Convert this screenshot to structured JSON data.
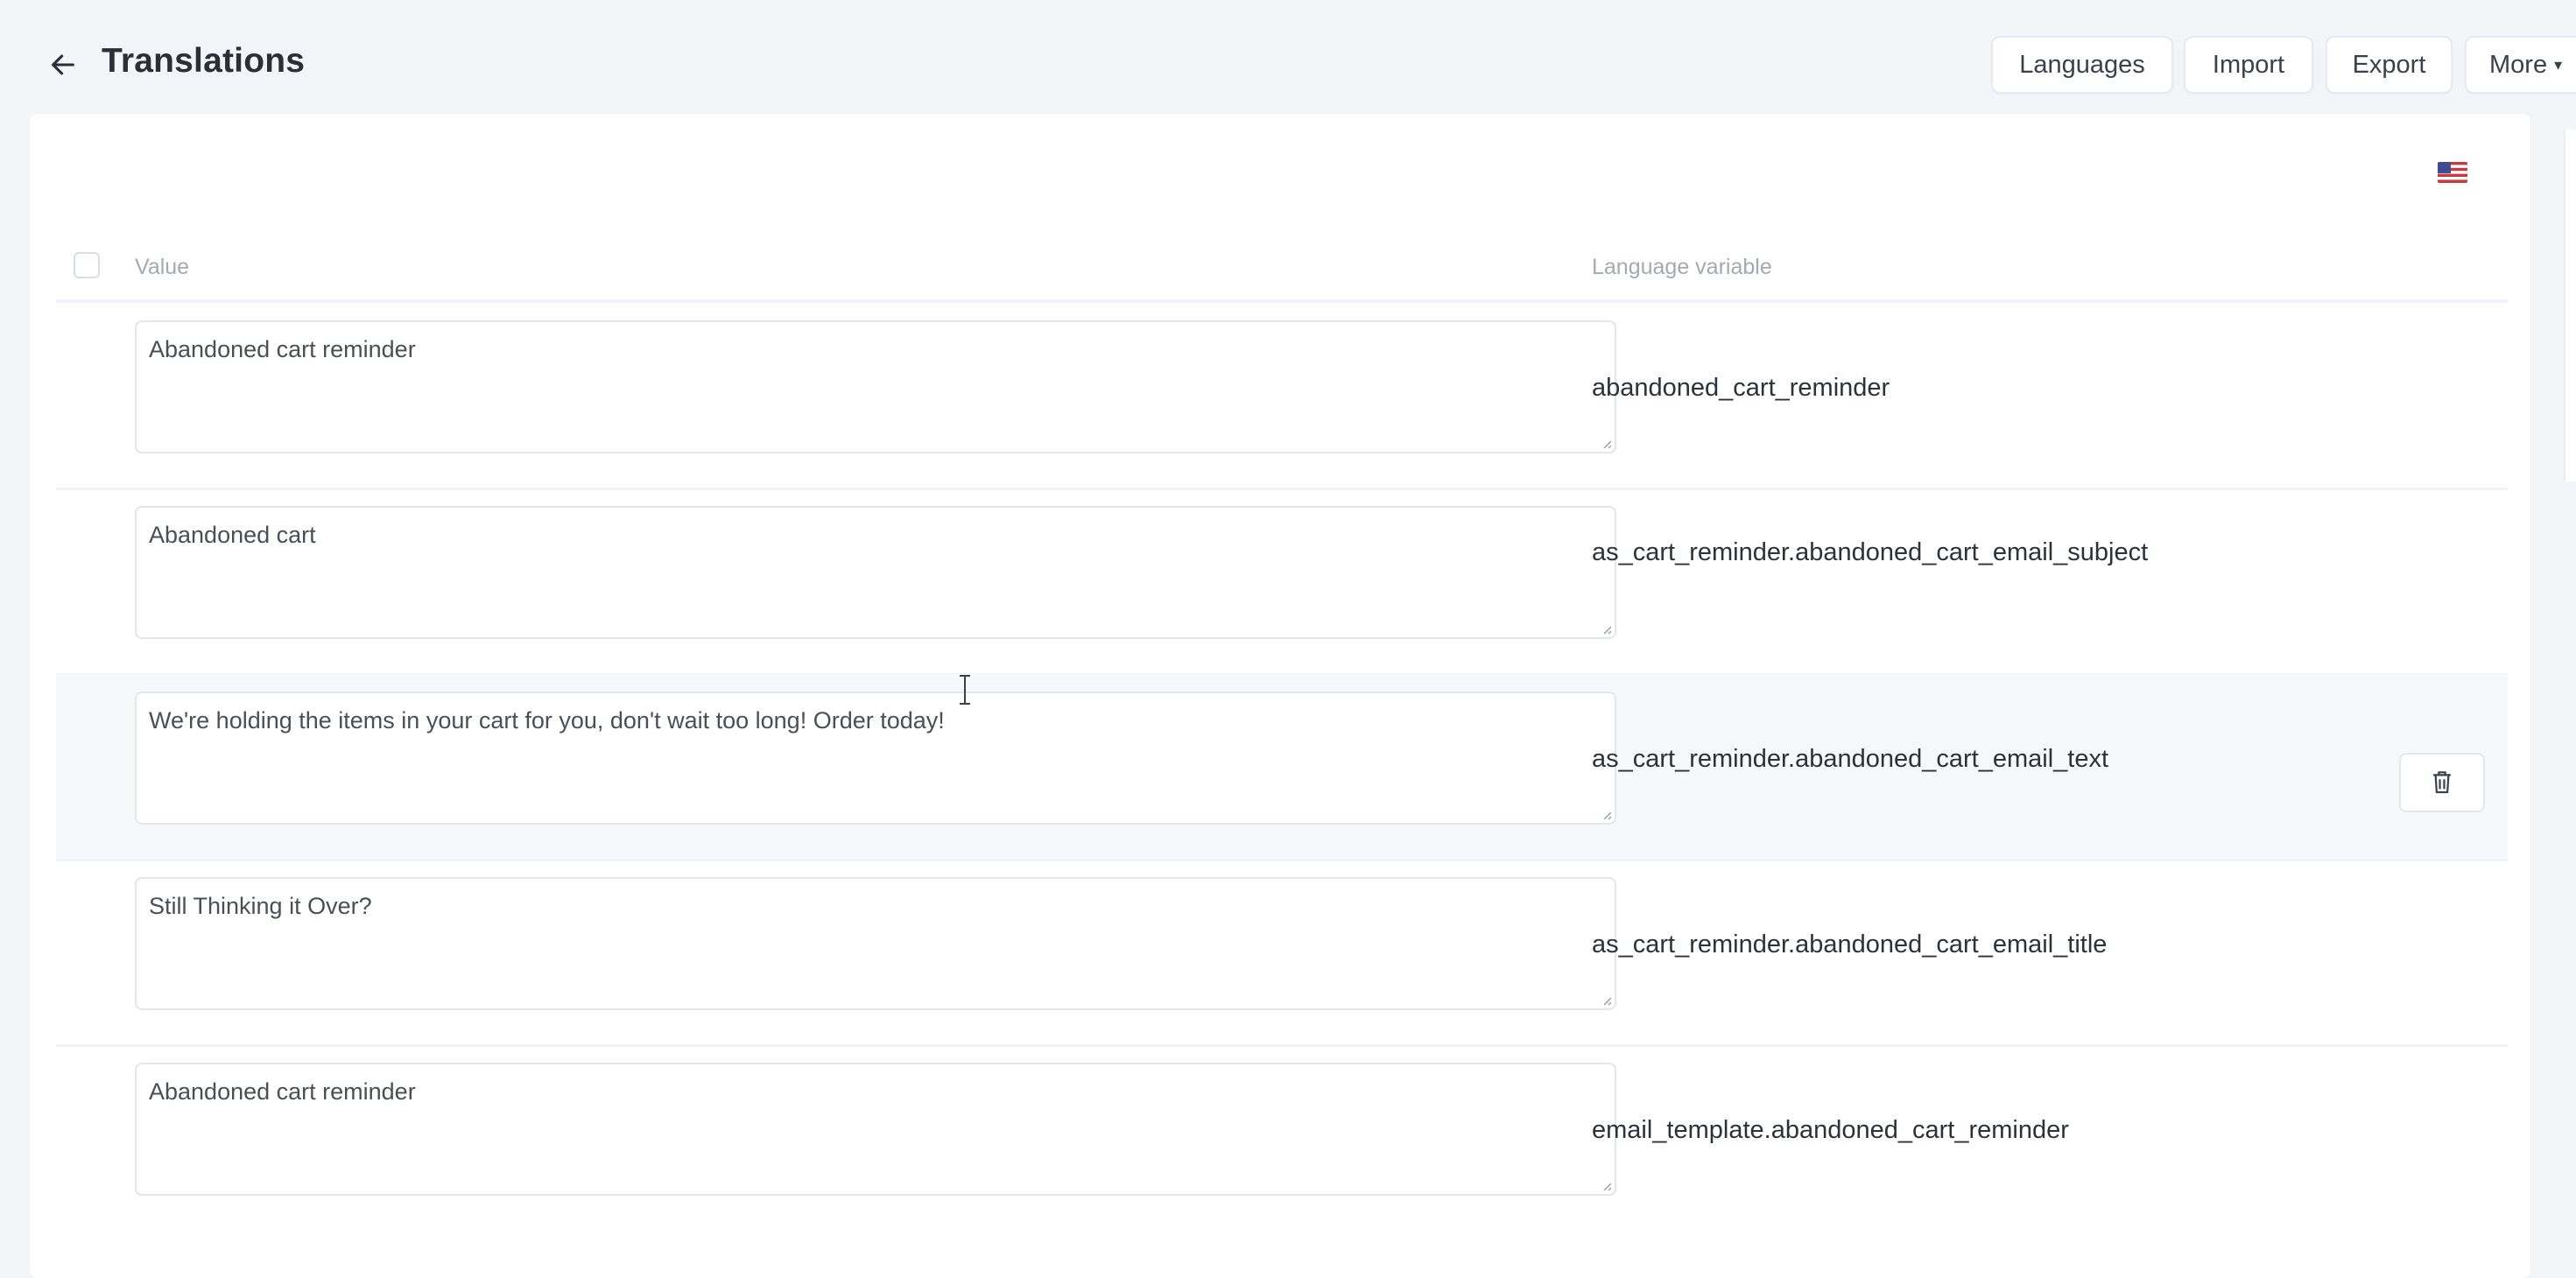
{
  "header": {
    "title": "Translations",
    "buttons": {
      "languages": "Languages",
      "import": "Import",
      "export": "Export",
      "more": "More"
    }
  },
  "table": {
    "columns": {
      "value": "Value",
      "language_variable": "Language variable"
    },
    "rows": [
      {
        "value": "Abandoned cart reminder",
        "variable": "abandoned_cart_reminder"
      },
      {
        "value": "Abandoned cart",
        "variable": "as_cart_reminder.abandoned_cart_email_subject"
      },
      {
        "value": "We're holding the items in your cart for you, don't wait too long! Order today!",
        "variable": "as_cart_reminder.abandoned_cart_email_text"
      },
      {
        "value": "Still Thinking it Over?",
        "variable": "as_cart_reminder.abandoned_cart_email_title"
      },
      {
        "value": "Abandoned cart reminder",
        "variable": "email_template.abandoned_cart_reminder"
      }
    ]
  },
  "icons": {
    "back": "arrow-left-icon",
    "flag": "us-flag-icon",
    "delete": "trash-icon",
    "caret": "caret-down-icon"
  },
  "colors": {
    "page_background": "#f3f5f9",
    "card_background": "#ffffff",
    "hovered_row": "#f7f8fa",
    "muted_text": "#a4a9b2"
  }
}
